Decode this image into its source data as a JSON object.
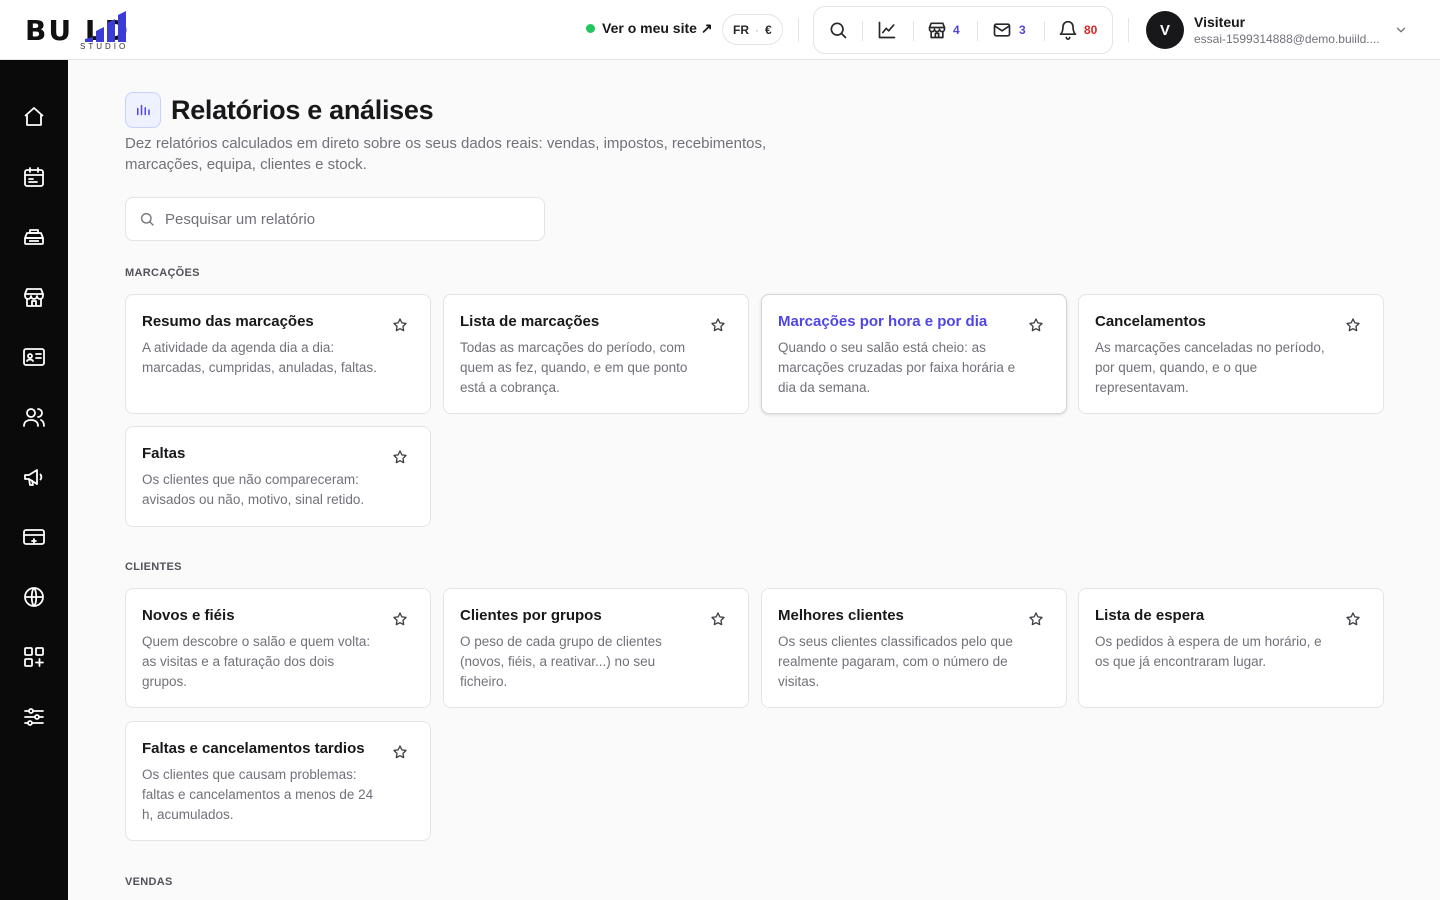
{
  "brand": {
    "logo_main": "BU  LD",
    "logo_sub": "STUDIO"
  },
  "header": {
    "site_link": "Ver o meu site ↗",
    "lang": "FR",
    "currency": "€",
    "counts": {
      "store": "4",
      "messages": "3",
      "notifications": "80"
    },
    "user": {
      "initial": "V",
      "name": "Visiteur",
      "email": "essai-1599314888@demo.buiild...."
    }
  },
  "page": {
    "title": "Relatórios e análises",
    "description": "Dez relatórios calculados em direto sobre os seus dados reais: vendas, impostos, recebimentos, marcações, equipa, clientes e stock.",
    "search_placeholder": "Pesquisar um relatório"
  },
  "sections": [
    {
      "label": "MARCAÇÕES",
      "cards": [
        {
          "title": "Resumo das marcações",
          "desc": "A atividade da agenda dia a dia: marcadas, cumpridas, anuladas, faltas."
        },
        {
          "title": "Lista de marcações",
          "desc": "Todas as marcações do período, com quem as fez, quando, e em que ponto está a cobrança."
        },
        {
          "title": "Marcações por hora e por dia",
          "desc": "Quando o seu salão está cheio: as marcações cruzadas por faixa horária e dia da semana."
        },
        {
          "title": "Cancelamentos",
          "desc": "As marcações canceladas no período, por quem, quando, e o que representavam."
        },
        {
          "title": "Faltas",
          "desc": "Os clientes que não compareceram: avisados ou não, motivo, sinal retido."
        }
      ]
    },
    {
      "label": "CLIENTES",
      "cards": [
        {
          "title": "Novos e fiéis",
          "desc": "Quem descobre o salão e quem volta: as visitas e a faturação dos dois grupos."
        },
        {
          "title": "Clientes por grupos",
          "desc": "O peso de cada grupo de clientes (novos, fiéis, a reativar...) no seu ficheiro."
        },
        {
          "title": "Melhores clientes",
          "desc": "Os seus clientes classificados pelo que realmente pagaram, com o número de visitas."
        },
        {
          "title": "Lista de espera",
          "desc": "Os pedidos à espera de um horário, e os que já encontraram lugar."
        },
        {
          "title": "Faltas e cancelamentos tardios",
          "desc": "Os clientes que causam problemas: faltas e cancelamentos a menos de 24 h, acumulados."
        }
      ]
    },
    {
      "label": "VENDAS"
    }
  ],
  "sidebar": {
    "icons": [
      "home-icon",
      "calendar-icon",
      "register-icon",
      "store-icon",
      "id-card-icon",
      "users-icon",
      "megaphone-icon",
      "payment-card-icon",
      "globe-icon",
      "apps-icon",
      "sliders-icon"
    ]
  },
  "colors": {
    "accent": "#4f46e5",
    "sidebar_bg": "#0a0a0a",
    "status_green": "#22c55e",
    "alert_red": "#dc2626"
  }
}
